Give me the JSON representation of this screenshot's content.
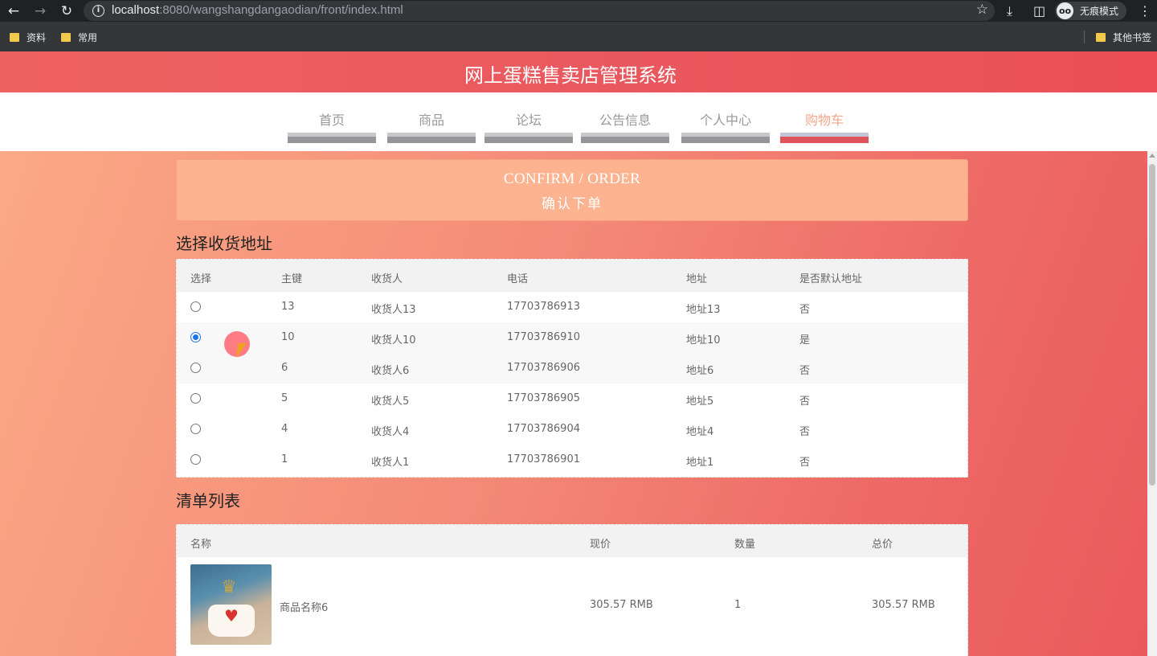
{
  "browser": {
    "url_host": "localhost",
    "url_rest": ":8080/wangshangdangaodian/front/index.html",
    "incognito_label": "无痕模式",
    "bookmarks": [
      "资料",
      "常用"
    ],
    "other_bookmarks": "其他书签"
  },
  "site": {
    "title": "网上蛋糕售卖店管理系统",
    "nav": [
      "首页",
      "商品",
      "论坛",
      "公告信息",
      "个人中心",
      "购物车"
    ],
    "active_nav": "购物车"
  },
  "confirm": {
    "title_en": "CONFIRM / ORDER",
    "title_cn": "确认下单"
  },
  "address_section": {
    "title": "选择收货地址",
    "headers": [
      "选择",
      "主键",
      "收货人",
      "电话",
      "地址",
      "是否默认地址"
    ],
    "rows": [
      {
        "id": "13",
        "name": "收货人13",
        "phone": "17703786913",
        "address": "地址13",
        "default": "否",
        "selected": false
      },
      {
        "id": "10",
        "name": "收货人10",
        "phone": "17703786910",
        "address": "地址10",
        "default": "是",
        "selected": true
      },
      {
        "id": "6",
        "name": "收货人6",
        "phone": "17703786906",
        "address": "地址6",
        "default": "否",
        "selected": false
      },
      {
        "id": "5",
        "name": "收货人5",
        "phone": "17703786905",
        "address": "地址5",
        "default": "否",
        "selected": false
      },
      {
        "id": "4",
        "name": "收货人4",
        "phone": "17703786904",
        "address": "地址4",
        "default": "否",
        "selected": false
      },
      {
        "id": "1",
        "name": "收货人1",
        "phone": "17703786901",
        "address": "地址1",
        "default": "否",
        "selected": false
      }
    ]
  },
  "list_section": {
    "title": "清单列表",
    "headers": [
      "名称",
      "现价",
      "数量",
      "总价"
    ],
    "items": [
      {
        "name": "商品名称6",
        "price": "305.57 RMB",
        "qty": "1",
        "total": "305.57 RMB"
      }
    ]
  }
}
